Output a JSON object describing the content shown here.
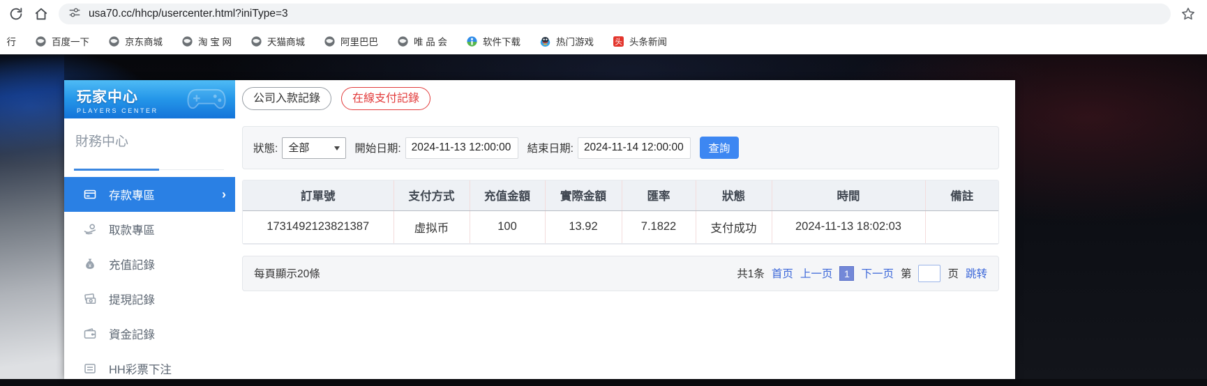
{
  "browser": {
    "url": "usa70.cc/hhcp/usercenter.html?iniType=3"
  },
  "bookmarks": {
    "clipped_item": "行",
    "items": [
      {
        "label": "百度一下",
        "icon": "globe"
      },
      {
        "label": "京东商城",
        "icon": "globe"
      },
      {
        "label": "淘 宝 网",
        "icon": "globe"
      },
      {
        "label": "天猫商城",
        "icon": "globe"
      },
      {
        "label": "阿里巴巴",
        "icon": "globe"
      },
      {
        "label": "唯 品 会",
        "icon": "globe"
      },
      {
        "label": "软件下载",
        "icon": "software"
      },
      {
        "label": "热门游戏",
        "icon": "game"
      },
      {
        "label": "头条新闻",
        "icon": "news",
        "badge": "头"
      }
    ]
  },
  "sidebar": {
    "title": "玩家中心",
    "subtitle": "PLAYERS CENTER",
    "section": "財務中心",
    "items": [
      {
        "label": "存款專區",
        "active": true,
        "chevron": "›"
      },
      {
        "label": "取款專區"
      },
      {
        "label": "充值記錄"
      },
      {
        "label": "提現記錄"
      },
      {
        "label": "資金記錄"
      },
      {
        "label": "HH彩票下注"
      }
    ]
  },
  "tabs": {
    "company_deposit": "公司入款記錄",
    "online_payment": "在線支付記錄"
  },
  "filters": {
    "status_label": "狀態:",
    "status_value": "全部",
    "start_label": "開始日期:",
    "start_value": "2024-11-13 12:00:00",
    "end_label": "結束日期:",
    "end_value": "2024-11-14 12:00:00",
    "search_button": "查詢"
  },
  "table": {
    "headers": [
      "訂單號",
      "支付方式",
      "充值金額",
      "實際金額",
      "匯率",
      "狀態",
      "時間",
      "備註"
    ],
    "rows": [
      [
        "1731492123821387",
        "虚拟币",
        "100",
        "13.92",
        "7.1822",
        "支付成功",
        "2024-11-13 18:02:03",
        ""
      ]
    ]
  },
  "pagination": {
    "page_size_text": "每頁顯示20條",
    "total_text": "共1条",
    "first": "首页",
    "prev": "上一页",
    "current_page": "1",
    "next": "下一页",
    "jump_prefix": "第",
    "jump_suffix": "页",
    "jump_button": "跳转"
  },
  "colors": {
    "accent_blue": "#2a80e4",
    "button_blue": "#3d87f2",
    "tab_red": "#e23b3b",
    "link_blue": "#3a66d9",
    "banner_gradient_top": "#4fbbf5",
    "banner_gradient_bottom": "#1474d9",
    "table_header_bg": "#eef1f5",
    "cell_divider_pink": "#f3dcdc"
  }
}
